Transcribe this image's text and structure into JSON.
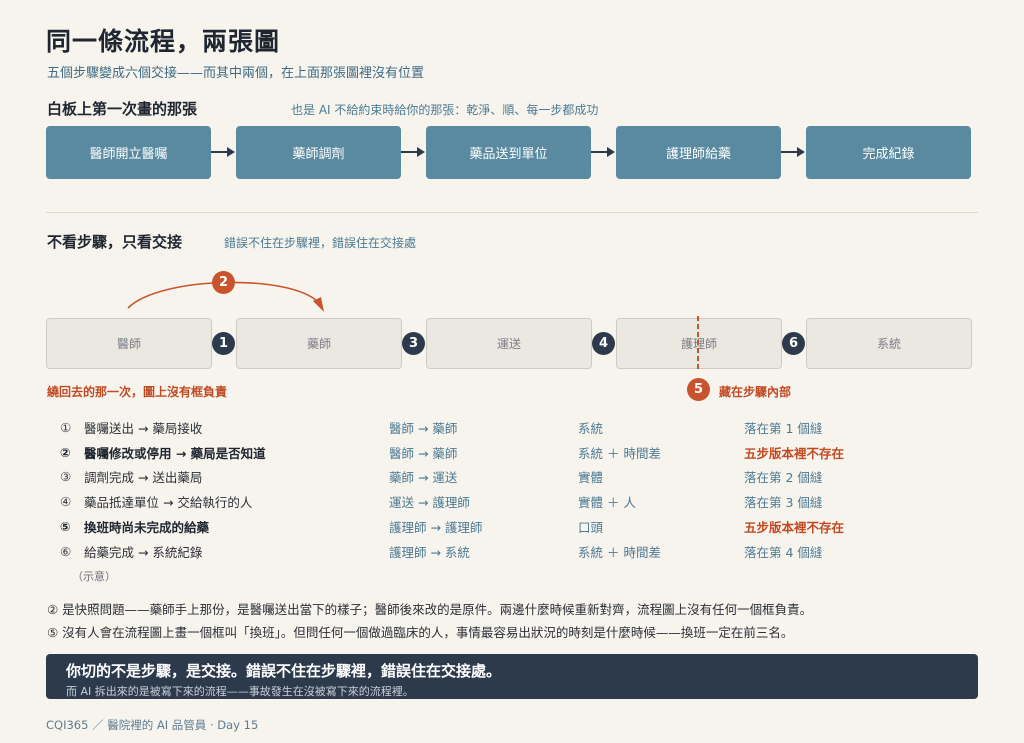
{
  "header": {
    "title": "同一條流程，兩張圖",
    "subtitle": "五個步驟變成六個交接——而其中兩個，在上面那張圖裡沒有位置"
  },
  "section1": {
    "title": "白板上第一次畫的那張",
    "note": "也是 AI 不給約束時給你的那張：乾淨、順、每一步都成功",
    "steps": [
      "醫師開立醫囑",
      "藥師調劑",
      "藥品送到單位",
      "護理師給藥",
      "完成紀錄"
    ]
  },
  "section2": {
    "title": "不看步驟，只看交接",
    "note": "錯誤不住在步驟裡，錯誤住在交接處",
    "boxes": [
      "醫師",
      "藥師",
      "運送",
      "護理師",
      "系統"
    ],
    "badges": [
      "1",
      "3",
      "4",
      "6"
    ],
    "loop_badge": "2",
    "loop_note": "繞回去的那一次，圖上沒有框負責",
    "inner_badge": "5",
    "inner_note": "藏在步驟內部"
  },
  "handoffs": [
    {
      "num": "①",
      "desc": "醫囑送出 → 藥局接收",
      "who": "醫師 → 藥師",
      "kind": "系統",
      "result": "落在第 1 個縫"
    },
    {
      "num": "②",
      "desc": "醫囑修改或停用 → 藥局是否知道",
      "who": "醫師 → 藥師",
      "kind": "系統 ＋ 時間差",
      "result": "五步版本裡不存在"
    },
    {
      "num": "③",
      "desc": "調劑完成 → 送出藥局",
      "who": "藥師 → 運送",
      "kind": "實體",
      "result": "落在第 2 個縫"
    },
    {
      "num": "④",
      "desc": "藥品抵達單位 → 交給執行的人",
      "who": "運送 → 護理師",
      "kind": "實體 ＋ 人",
      "result": "落在第 3 個縫"
    },
    {
      "num": "⑤",
      "desc": "換班時尚未完成的給藥",
      "who": "護理師 → 護理師",
      "kind": "口頭",
      "result": "五步版本裡不存在"
    },
    {
      "num": "⑥",
      "desc": "給藥完成 → 系統紀錄",
      "who": "護理師 → 系統",
      "kind": "系統 ＋ 時間差",
      "result": "落在第 4 個縫"
    }
  ],
  "demo_label": "（示意）",
  "notes": [
    "② 是快照問題——藥師手上那份，是醫囑送出當下的樣子；醫師後來改的是原件。兩邊什麼時候重新對齊，流程圖上沒有任何一個框負責。",
    "⑤ 沒有人會在流程圖上畫一個框叫「換班」。但問任何一個做過臨床的人，事情最容易出狀況的時刻是什麼時候——換班一定在前三名。"
  ],
  "callout": {
    "headline": "你切的不是步驟，是交接。錯誤不住在步驟裡，錯誤住在交接處。",
    "sub": "而 AI 拆出來的是被寫下來的流程——事故發生在沒被寫下來的流程裡。"
  },
  "footer": "CQI365 ／ 醫院裡的 AI 品管員 · Day 15",
  "colors": {
    "step_fill": "#5a8aa0",
    "accent_red": "#c9532c",
    "dark_navy": "#2c3a4c",
    "box_fill": "#ebe7e1"
  }
}
